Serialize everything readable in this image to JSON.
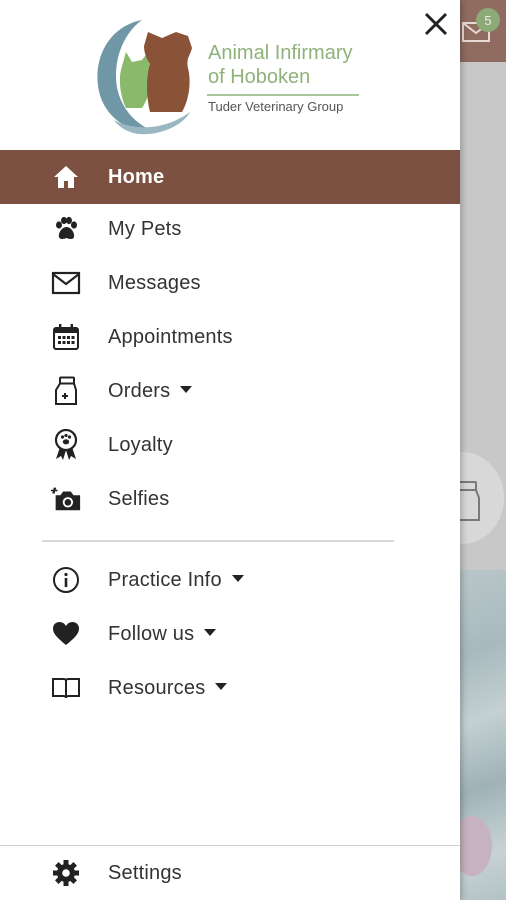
{
  "app": {
    "logo_line1": "Animal Infirmary",
    "logo_line2": "of Hoboken",
    "logo_tagline": "Tuder Veterinary Group",
    "message_badge": "5"
  },
  "menu": {
    "items": [
      {
        "label": "Home",
        "icon": "home-icon",
        "active": true
      },
      {
        "label": "My Pets",
        "icon": "paw-icon"
      },
      {
        "label": "Messages",
        "icon": "envelope-icon"
      },
      {
        "label": "Appointments",
        "icon": "calendar-icon"
      },
      {
        "label": "Orders",
        "icon": "medicine-bottle-icon",
        "dropdown": true
      },
      {
        "label": "Loyalty",
        "icon": "award-ribbon-icon"
      },
      {
        "label": "Selfies",
        "icon": "camera-icon"
      }
    ],
    "secondary": [
      {
        "label": "Practice Info",
        "icon": "info-icon",
        "dropdown": true
      },
      {
        "label": "Follow us",
        "icon": "heart-icon",
        "dropdown": true
      },
      {
        "label": "Resources",
        "icon": "book-icon",
        "dropdown": true
      }
    ],
    "settings": {
      "label": "Settings",
      "icon": "gear-icon"
    }
  },
  "colors": {
    "active_bg": "#7c5142",
    "header_bg": "#8f6b60",
    "logo_green": "#8db37a",
    "badge_green": "#8ea978"
  }
}
